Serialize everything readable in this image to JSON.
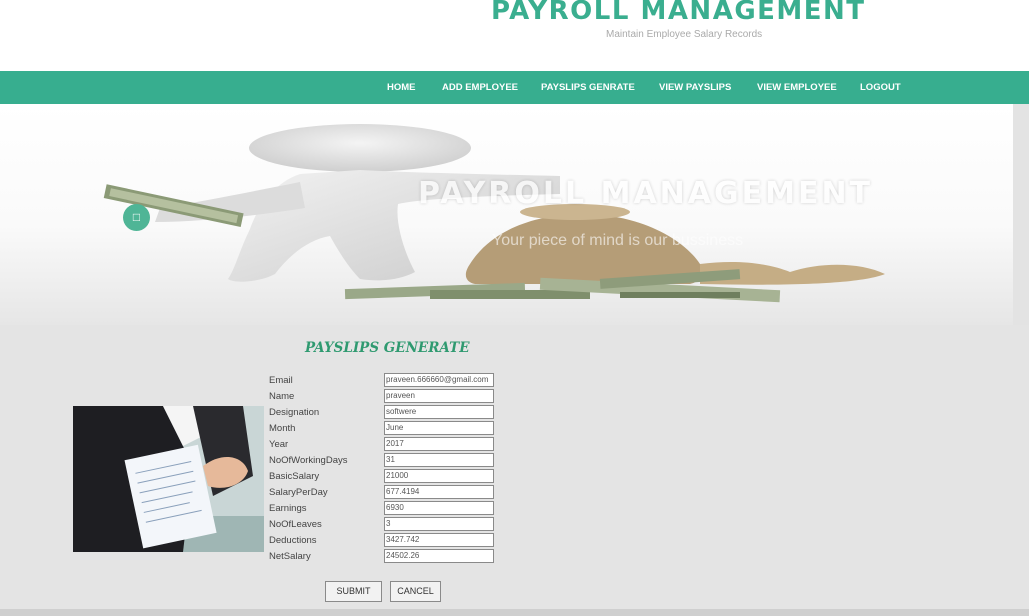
{
  "header": {
    "title": "PAYROLL MANAGEMENT",
    "subtitle": "Maintain Employee Salary Records"
  },
  "nav": {
    "items": [
      {
        "label": "HOME"
      },
      {
        "label": "ADD EMPLOYEE"
      },
      {
        "label": "PAYSLIPS GENRATE"
      },
      {
        "label": "VIEW PAYSLIPS"
      },
      {
        "label": "VIEW EMPLOYEE"
      },
      {
        "label": "LOGOUT"
      }
    ]
  },
  "banner": {
    "title": "PAYROLL MANAGEMENT",
    "tagline": "Your piece of mind is our bussiness",
    "button_icon": "square-icon"
  },
  "form": {
    "heading": "PAYSLIPS GENERATE",
    "fields": [
      {
        "label": "Email",
        "value": "praveen.666660@gmail.com"
      },
      {
        "label": "Name",
        "value": "praveen"
      },
      {
        "label": "Designation",
        "value": "softwere"
      },
      {
        "label": "Month",
        "value": "June"
      },
      {
        "label": "Year",
        "value": "2017"
      },
      {
        "label": "NoOfWorkingDays",
        "value": "31"
      },
      {
        "label": "BasicSalary",
        "value": "21000"
      },
      {
        "label": "SalaryPerDay",
        "value": "677.4194"
      },
      {
        "label": "Earnings",
        "value": "6930"
      },
      {
        "label": "NoOfLeaves",
        "value": "3"
      },
      {
        "label": "Deductions",
        "value": "3427.742"
      },
      {
        "label": "NetSalary",
        "value": "24502.26"
      }
    ],
    "submit_label": "SUBMIT",
    "cancel_label": "CANCEL"
  },
  "colors": {
    "accent": "#37ae8f",
    "heading": "#2f9a70",
    "background": "#e4e4e4"
  }
}
